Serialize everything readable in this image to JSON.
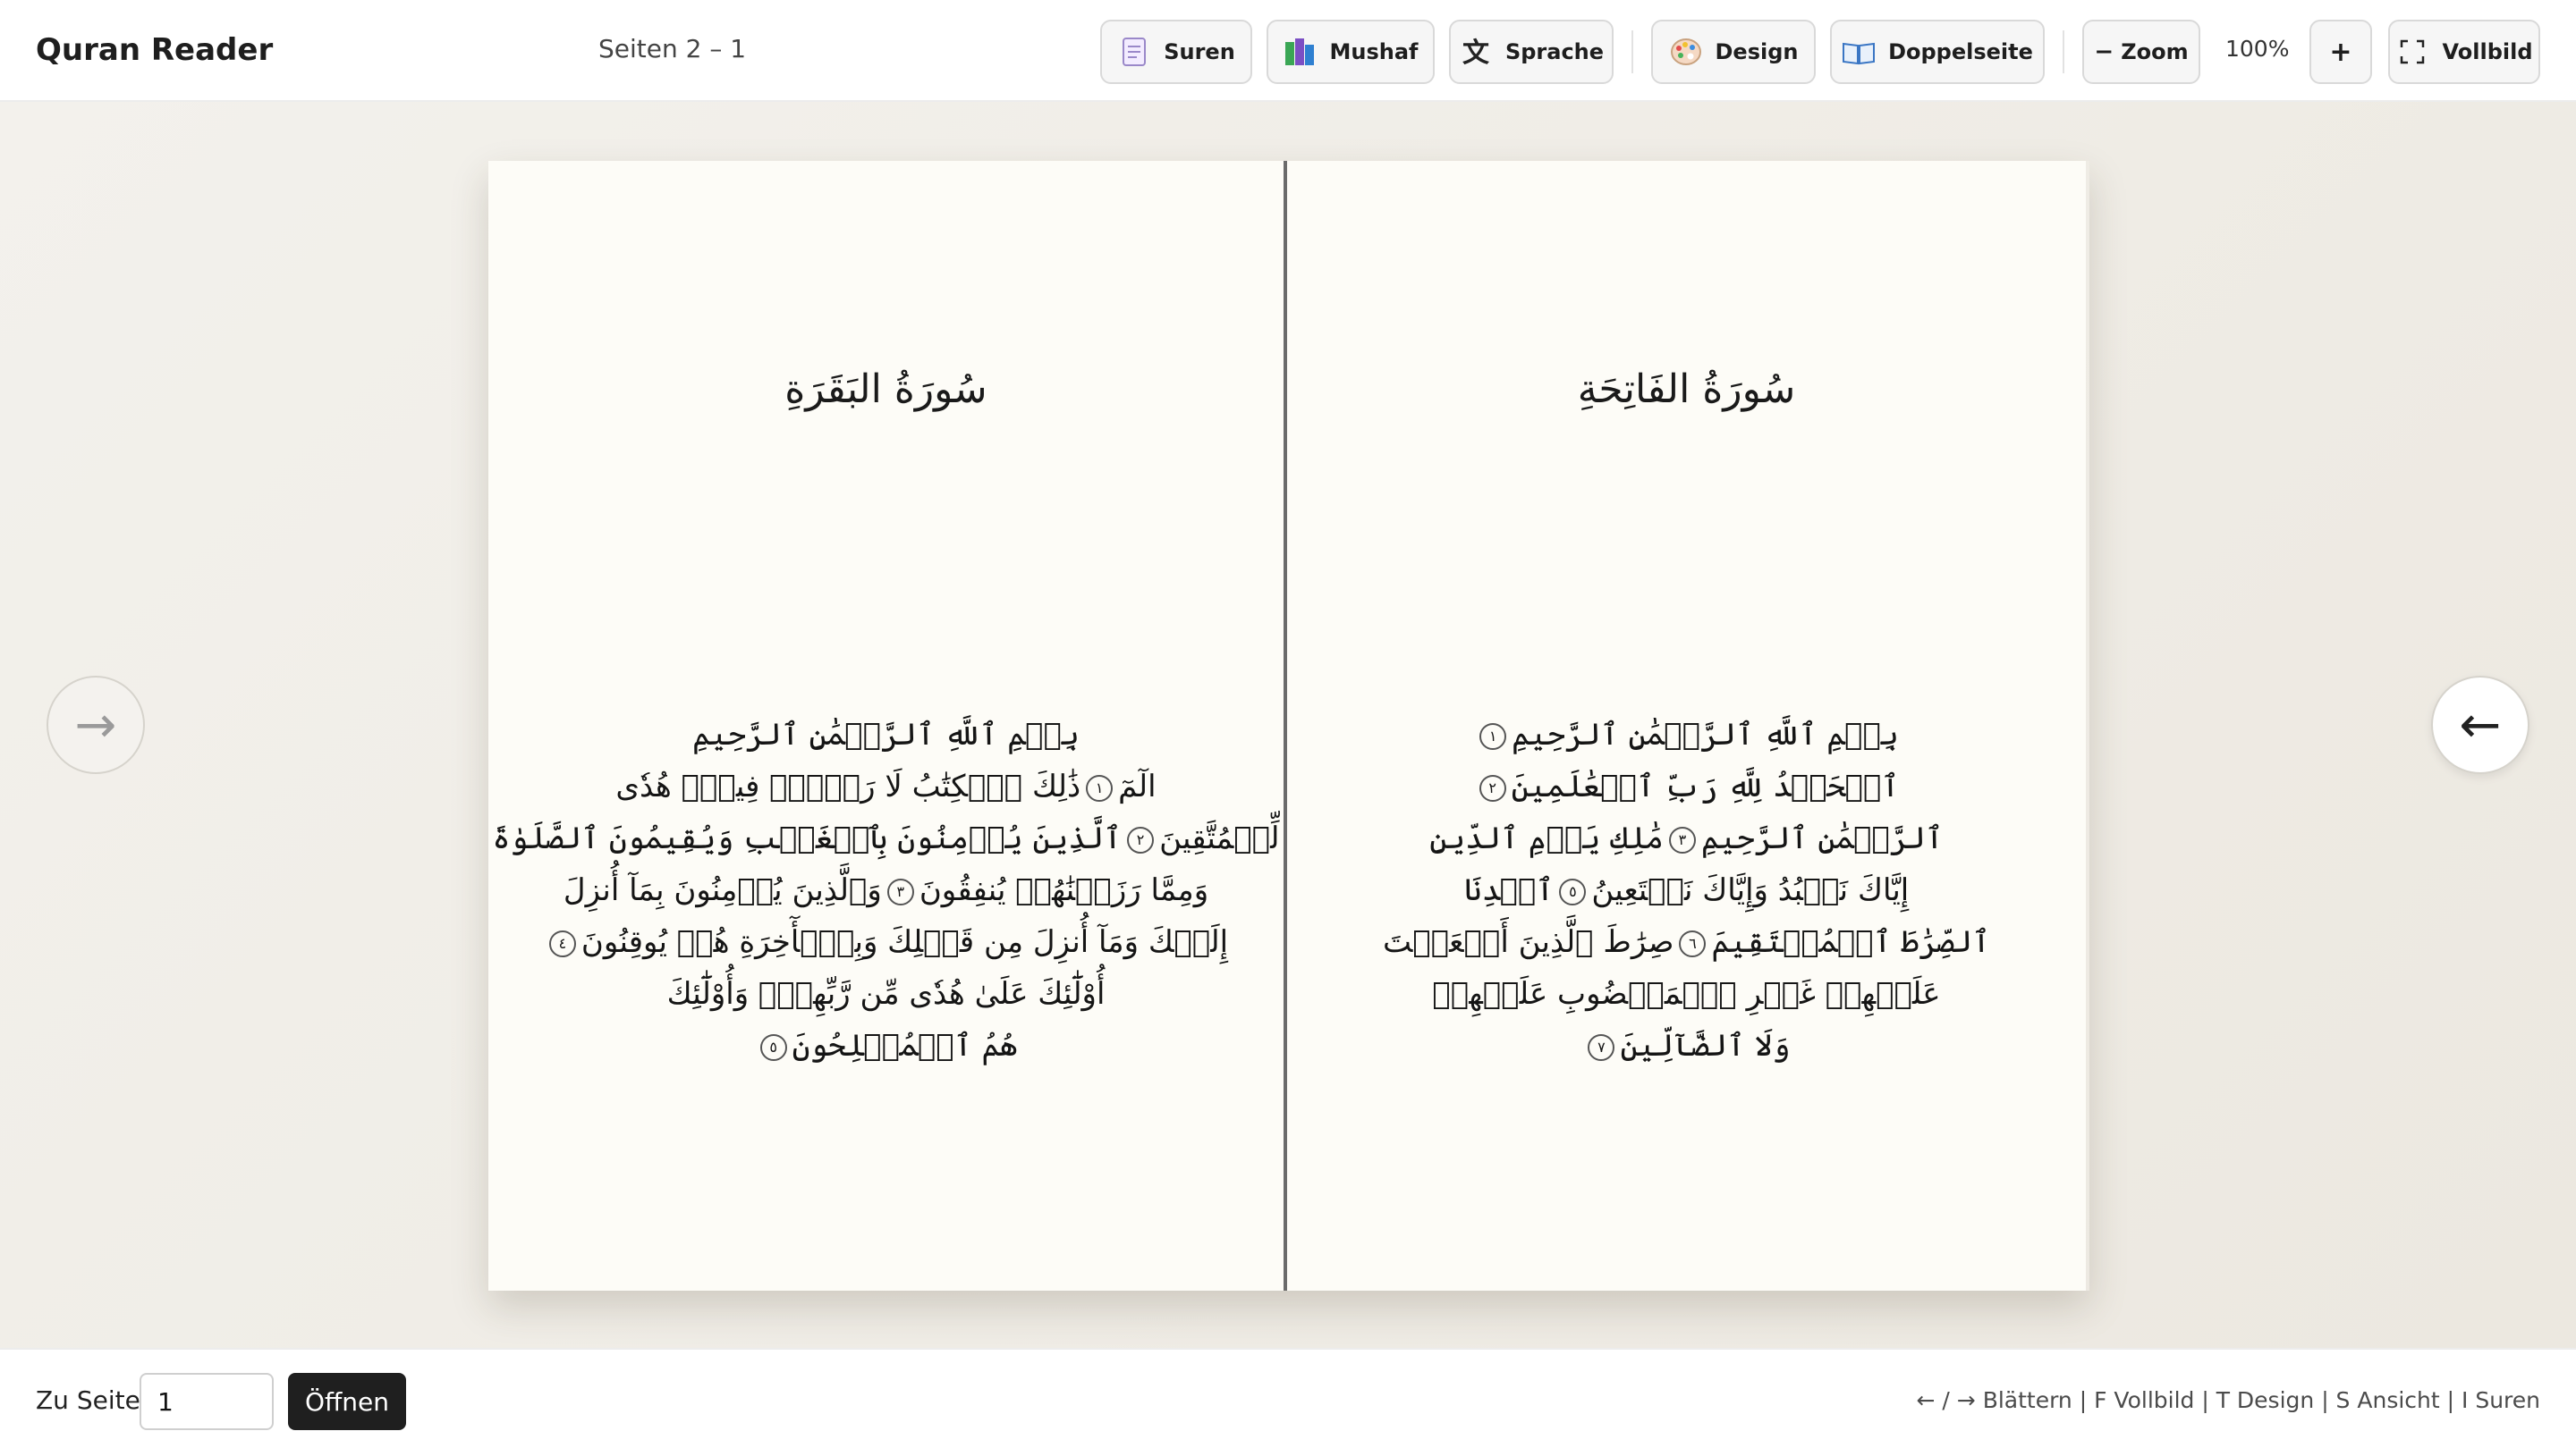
{
  "app": {
    "title": "Quran Reader",
    "page_indicator": "Seiten 2 – 1"
  },
  "toolbar": {
    "suren": "Suren",
    "mushaf": "Mushaf",
    "sprache": "Sprache",
    "design": "Design",
    "doppelseite": "Doppelseite",
    "zoom_out": "Zoom",
    "zoom_out_symbol": "−",
    "zoom_level": "100%",
    "zoom_in": "+",
    "vollbild": "Vollbild"
  },
  "pages": {
    "left": {
      "sura_title": "سُورَةُ البَقَرَةِ",
      "lines": [
        {
          "text": "بِسۡمِ ٱللَّهِ ٱلرَّحۡمَٰنِ ٱلرَّحِيمِ",
          "marker": ""
        },
        {
          "text": "الٓمٓ",
          "marker": "١",
          "after": "ذَٰلِكَ ٱلۡكِتَٰبُ لَا رَيۡبَۛ فِيهِۛ هُدٗى"
        },
        {
          "text": "لِّلۡمُتَّقِينَ",
          "marker": "٢",
          "after": "ٱلَّذِينَ يُؤۡمِنُونَ بِٱلۡغَيۡبِ وَيُقِيمُونَ ٱلصَّلَوٰةَ"
        },
        {
          "text": "وَمِمَّا رَزَقۡنَٰهُمۡ يُنفِقُونَ",
          "marker": "٣",
          "after": "وَٱلَّذِينَ يُؤۡمِنُونَ بِمَآ أُنزِلَ"
        },
        {
          "text": "إِلَيۡكَ وَمَآ أُنزِلَ مِن قَبۡلِكَ وَبِٱلۡأٓخِرَةِ هُمۡ يُوقِنُونَ",
          "marker": "٤",
          "after": ""
        },
        {
          "text": "أُوْلَٰٓئِكَ عَلَىٰ هُدٗى مِّن رَّبِّهِمۡۖ وَأُوْلَٰٓئِكَ",
          "marker": "",
          "after": ""
        },
        {
          "text": "هُمُ ٱلۡمُفۡلِحُونَ",
          "marker": "٥",
          "after": ""
        }
      ]
    },
    "right": {
      "sura_title": "سُورَةُ الفَاتِحَةِ",
      "lines": [
        {
          "text": "بِسۡمِ ٱللَّهِ ٱلرَّحۡمَٰنِ ٱلرَّحِيمِ",
          "marker": "١",
          "after": ""
        },
        {
          "text": "ٱلۡحَمۡدُ لِلَّهِ رَبِّ ٱلۡعَٰلَمِينَ",
          "marker": "٢",
          "after": ""
        },
        {
          "text": "ٱلرَّحۡمَٰنِ ٱلرَّحِيمِ",
          "marker": "٣",
          "after": "مَٰلِكِ يَوۡمِ ٱلدِّينِ"
        },
        {
          "text": "إِيَّاكَ نَعۡبُدُ وَإِيَّاكَ نَسۡتَعِينُ",
          "marker": "٥",
          "after": "ٱهۡدِنَا"
        },
        {
          "text": "ٱلصِّرَٰطَ ٱلۡمُسۡتَقِيمَ",
          "marker": "٦",
          "after": "صِرَٰطَ ٱلَّذِينَ أَنۡعَمۡتَ"
        },
        {
          "text": "عَلَيۡهِمۡ غَيۡرِ ٱلۡمَغۡضُوبِ عَلَيۡهِمۡ",
          "marker": "",
          "after": ""
        },
        {
          "text": "وَلَا ٱلضَّآلِّينَ",
          "marker": "٧",
          "after": ""
        }
      ]
    }
  },
  "navigation": {
    "prev_arrow": "→",
    "next_arrow": "←"
  },
  "footer": {
    "goto_label": "Zu Seite",
    "goto_value": "1",
    "goto_button": "Öffnen",
    "shortcuts": "← / → Blättern | F Vollbild | T Design | S Ansicht | I Suren"
  }
}
